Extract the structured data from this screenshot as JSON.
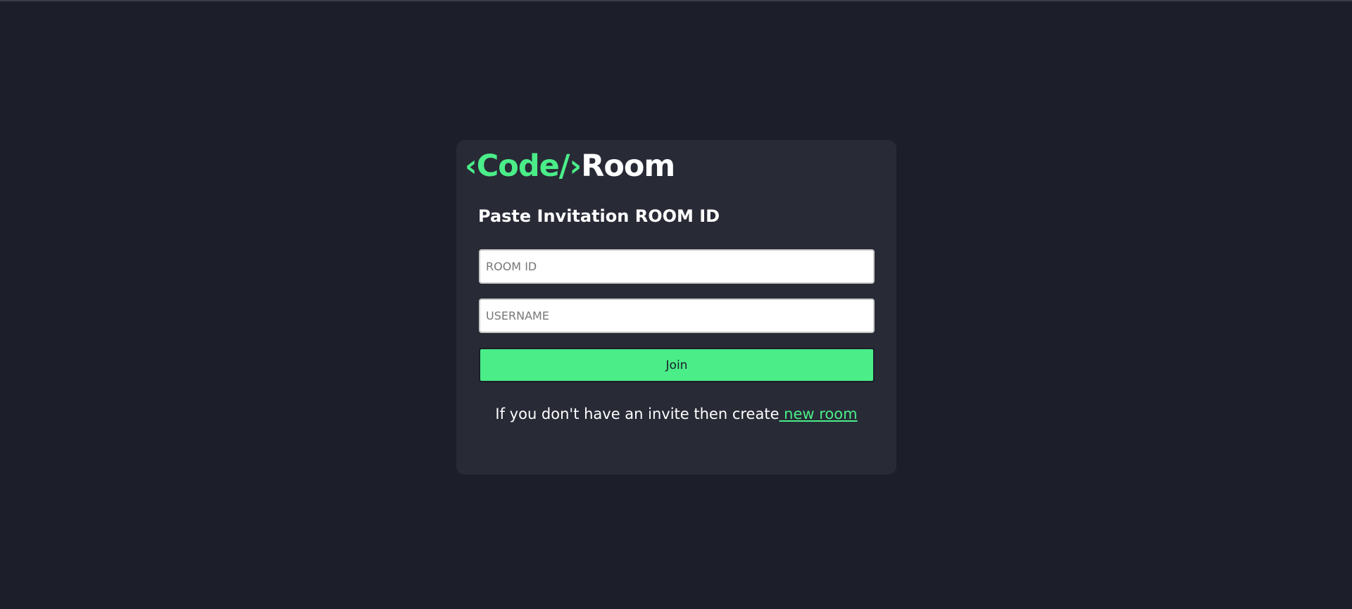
{
  "brand": {
    "code": "‹Code/›",
    "room": "Room"
  },
  "form": {
    "heading": "Paste Invitation ROOM ID",
    "room_id_placeholder": "ROOM ID",
    "username_placeholder": "USERNAME",
    "join_label": "Join"
  },
  "footer": {
    "text": "If you don't have an invite then create",
    "link": " new room"
  },
  "colors": {
    "background": "#1c1e29",
    "card": "#282a36",
    "accent": "#4aed88"
  }
}
